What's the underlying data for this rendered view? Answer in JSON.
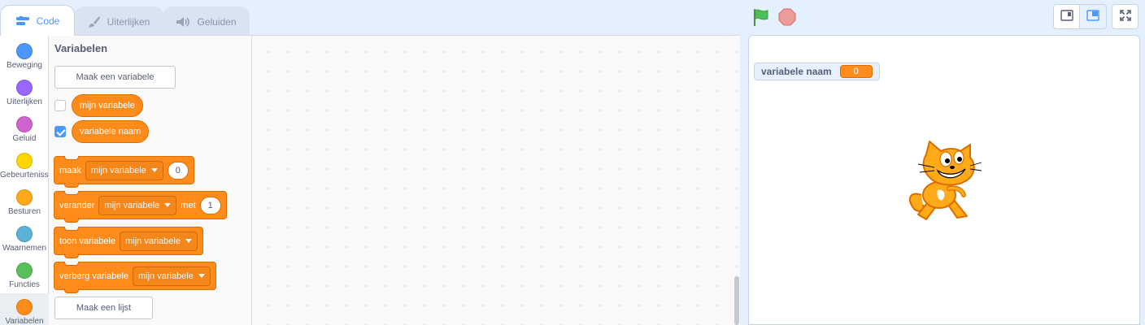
{
  "tabs": [
    {
      "label": "Code",
      "icon": "code-icon"
    },
    {
      "label": "Uiterlijken",
      "icon": "brush-icon"
    },
    {
      "label": "Geluiden",
      "icon": "speaker-icon"
    }
  ],
  "categories": [
    {
      "label": "Beweging",
      "color": "#4c97ff"
    },
    {
      "label": "Uiterlijken",
      "color": "#9966ff"
    },
    {
      "label": "Geluid",
      "color": "#cf63cf"
    },
    {
      "label": "Gebeurtenissen",
      "color": "#ffd500"
    },
    {
      "label": "Besturen",
      "color": "#ffab19"
    },
    {
      "label": "Waarnemen",
      "color": "#5cb1d6"
    },
    {
      "label": "Functies",
      "color": "#59c059"
    },
    {
      "label": "Variabelen",
      "color": "#ff8c1a"
    }
  ],
  "palette": {
    "heading": "Variabelen",
    "make_variable_label": "Maak een variabele",
    "make_list_label": "Maak een lijst",
    "variables": [
      {
        "name": "mijn variabele",
        "checked": false
      },
      {
        "name": "variabele naam",
        "checked": true
      }
    ],
    "blocks": {
      "set": {
        "word": "maak",
        "var": "mijn variabele",
        "value": "0"
      },
      "change": {
        "word": "verander",
        "var": "mijn variabele",
        "word2": "met",
        "value": "1"
      },
      "show": {
        "word": "toon variabele",
        "var": "mijn variabele"
      },
      "hide": {
        "word": "verberg variabele",
        "var": "mijn variabele"
      }
    }
  },
  "stage": {
    "monitor_label": "variabele naam",
    "monitor_value": "0"
  },
  "colors": {
    "accent": "#4c97ff",
    "variables": "#ff8c1a",
    "flag": "#4cbf56",
    "stop": "#ec5959"
  }
}
